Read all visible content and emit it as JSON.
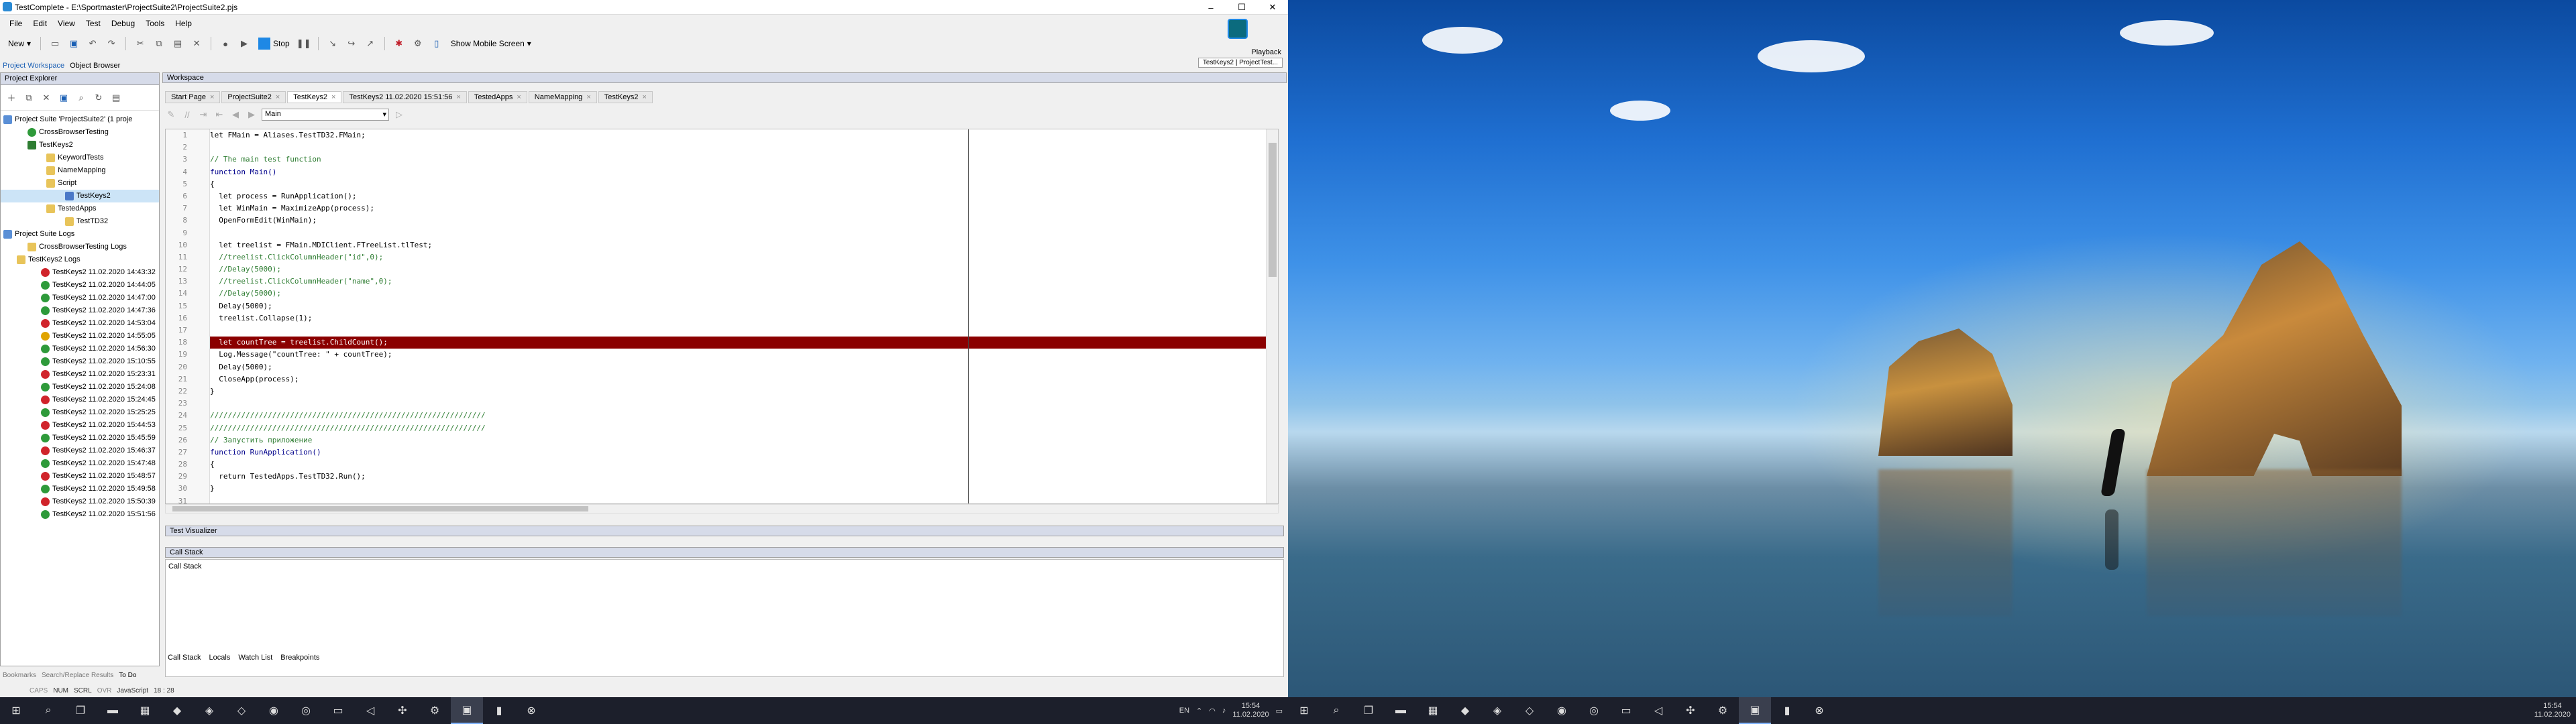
{
  "window": {
    "title": "TestComplete - E:\\Sportmaster\\ProjectSuite2\\ProjectSuite2.pjs",
    "controls": [
      "–",
      "☐",
      "✕"
    ]
  },
  "menu": [
    "File",
    "Edit",
    "View",
    "Test",
    "Debug",
    "Tools",
    "Help"
  ],
  "toolbar": {
    "new_label": "New",
    "stop_label": "Stop",
    "mobile_label": "Show Mobile Screen"
  },
  "playback": {
    "label": "Playback",
    "proxy_label": "TestKeys2 | ProjectTest..."
  },
  "left_tabs": [
    "Project Workspace",
    "Object Browser"
  ],
  "explorer": {
    "title": "Project Explorer",
    "tree": [
      {
        "label": "Project Suite 'ProjectSuite2' (1 proje",
        "icon": "suite",
        "indent": 4
      },
      {
        "label": "CrossBrowserTesting",
        "icon": "ok",
        "indent": 40
      },
      {
        "label": "TestKeys2",
        "icon": "proj",
        "indent": 40
      },
      {
        "label": "KeywordTests",
        "icon": "folder",
        "indent": 68
      },
      {
        "label": "NameMapping",
        "icon": "folder",
        "indent": 68
      },
      {
        "label": "Script",
        "icon": "folder",
        "indent": 68
      },
      {
        "label": "TestKeys2",
        "icon": "script",
        "indent": 96,
        "selected": true
      },
      {
        "label": "TestedApps",
        "icon": "folder",
        "indent": 68
      },
      {
        "label": "TestTD32",
        "icon": "folder",
        "indent": 96
      },
      {
        "label": "Project Suite Logs",
        "icon": "suite",
        "indent": 4
      },
      {
        "label": "CrossBrowserTesting Logs",
        "icon": "folder",
        "indent": 40
      },
      {
        "label": "TestKeys2 Logs",
        "icon": "folder",
        "indent": 24
      },
      {
        "label": "TestKeys2 11.02.2020 14:43:32",
        "icon": "fail",
        "indent": 60
      },
      {
        "label": "TestKeys2 11.02.2020 14:44:05",
        "icon": "ok",
        "indent": 60
      },
      {
        "label": "TestKeys2 11.02.2020 14:47:00",
        "icon": "ok",
        "indent": 60
      },
      {
        "label": "TestKeys2 11.02.2020 14:47:36",
        "icon": "ok",
        "indent": 60
      },
      {
        "label": "TestKeys2 11.02.2020 14:53:04",
        "icon": "fail",
        "indent": 60
      },
      {
        "label": "TestKeys2 11.02.2020 14:55:05",
        "icon": "warn",
        "indent": 60
      },
      {
        "label": "TestKeys2 11.02.2020 14:56:30",
        "icon": "ok",
        "indent": 60
      },
      {
        "label": "TestKeys2 11.02.2020 15:10:55",
        "icon": "ok",
        "indent": 60
      },
      {
        "label": "TestKeys2 11.02.2020 15:23:31",
        "icon": "fail",
        "indent": 60
      },
      {
        "label": "TestKeys2 11.02.2020 15:24:08",
        "icon": "ok",
        "indent": 60
      },
      {
        "label": "TestKeys2 11.02.2020 15:24:45",
        "icon": "fail",
        "indent": 60
      },
      {
        "label": "TestKeys2 11.02.2020 15:25:25",
        "icon": "ok",
        "indent": 60
      },
      {
        "label": "TestKeys2 11.02.2020 15:44:53",
        "icon": "fail",
        "indent": 60
      },
      {
        "label": "TestKeys2 11.02.2020 15:45:59",
        "icon": "ok",
        "indent": 60
      },
      {
        "label": "TestKeys2 11.02.2020 15:46:37",
        "icon": "fail",
        "indent": 60
      },
      {
        "label": "TestKeys2 11.02.2020 15:47:48",
        "icon": "ok",
        "indent": 60
      },
      {
        "label": "TestKeys2 11.02.2020 15:48:57",
        "icon": "fail",
        "indent": 60
      },
      {
        "label": "TestKeys2 11.02.2020 15:49:58",
        "icon": "ok",
        "indent": 60
      },
      {
        "label": "TestKeys2 11.02.2020 15:50:39",
        "icon": "fail",
        "indent": 60
      },
      {
        "label": "TestKeys2 11.02.2020 15:51:56",
        "icon": "ok",
        "indent": 60
      }
    ],
    "bottom_tabs": [
      "Bookmarks",
      "Search/Replace Results",
      "To Do"
    ]
  },
  "workspace": {
    "title": "Workspace",
    "tabs": [
      {
        "label": "Start Page",
        "active": false
      },
      {
        "label": "ProjectSuite2",
        "active": false
      },
      {
        "label": "TestKeys2",
        "active": true
      },
      {
        "label": "TestKeys2 11.02.2020 15:51:56",
        "active": false
      },
      {
        "label": "TestedApps",
        "active": false
      },
      {
        "label": "NameMapping",
        "active": false
      },
      {
        "label": "TestKeys2",
        "active": false
      }
    ],
    "routine": "Main",
    "code": [
      {
        "n": "1",
        "text": "let FMain = Aliases.TestTD32.FMain;",
        "cls": ""
      },
      {
        "n": "2",
        "text": "",
        "cls": ""
      },
      {
        "n": "3",
        "text": "// The main test function",
        "cls": "comment"
      },
      {
        "n": "4",
        "text": "function Main()",
        "cls": "kw"
      },
      {
        "n": "5",
        "text": "{",
        "cls": ""
      },
      {
        "n": "6",
        "text": "  let process = RunApplication();",
        "cls": ""
      },
      {
        "n": "7",
        "text": "  let WinMain = MaximizeApp(process);",
        "cls": ""
      },
      {
        "n": "8",
        "text": "  OpenFormEdit(WinMain);",
        "cls": ""
      },
      {
        "n": "9",
        "text": "",
        "cls": ""
      },
      {
        "n": "10",
        "text": "  let treelist = FMain.MDIClient.FTreeList.tlTest;",
        "cls": ""
      },
      {
        "n": "11",
        "text": "  //treelist.ClickColumnHeader(\"id\",0);",
        "cls": "comment"
      },
      {
        "n": "12",
        "text": "  //Delay(5000);",
        "cls": "comment"
      },
      {
        "n": "13",
        "text": "  //treelist.ClickColumnHeader(\"name\",0);",
        "cls": "comment"
      },
      {
        "n": "14",
        "text": "  //Delay(5000);",
        "cls": "comment"
      },
      {
        "n": "15",
        "text": "  Delay(5000);",
        "cls": ""
      },
      {
        "n": "16",
        "text": "  treelist.Collapse(1);",
        "cls": ""
      },
      {
        "n": "17",
        "text": "",
        "cls": ""
      },
      {
        "n": "18",
        "text": "  let countTree = treelist.ChildCount();",
        "cls": "hl"
      },
      {
        "n": "19",
        "text": "  Log.Message(\"countTree: \" + countTree);",
        "cls": ""
      },
      {
        "n": "20",
        "text": "  Delay(5000);",
        "cls": ""
      },
      {
        "n": "21",
        "text": "  CloseApp(process);",
        "cls": ""
      },
      {
        "n": "22",
        "text": "}",
        "cls": ""
      },
      {
        "n": "23",
        "text": "",
        "cls": ""
      },
      {
        "n": "24",
        "text": "//////////////////////////////////////////////////////////////",
        "cls": "comment"
      },
      {
        "n": "25",
        "text": "//////////////////////////////////////////////////////////////",
        "cls": "comment"
      },
      {
        "n": "26",
        "text": "// Запустить приложение",
        "cls": "comment"
      },
      {
        "n": "27",
        "text": "function RunApplication()",
        "cls": "kw"
      },
      {
        "n": "28",
        "text": "{",
        "cls": ""
      },
      {
        "n": "29",
        "text": "  return TestedApps.TestTD32.Run();",
        "cls": ""
      },
      {
        "n": "30",
        "text": "}",
        "cls": ""
      },
      {
        "n": "31",
        "text": "",
        "cls": ""
      }
    ],
    "test_visualizer": "Test Visualizer",
    "call_stack_title": "Call Stack",
    "call_stack_body": "Call Stack",
    "bottom_tabs": [
      "Call Stack",
      "Locals",
      "Watch List",
      "Breakpoints"
    ]
  },
  "status": {
    "caps": "CAPS",
    "num": "NUM",
    "scrl": "SCRL",
    "ovr": "OVR",
    "lang": "JavaScript",
    "pos": "18 : 28"
  },
  "taskbar": {
    "lang": "EN",
    "time": "15:54",
    "date": "11.02.2020"
  }
}
